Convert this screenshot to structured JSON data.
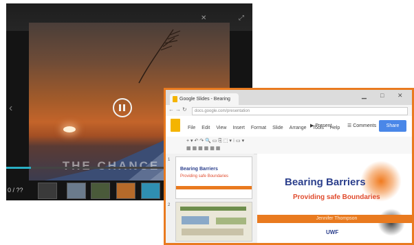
{
  "video_player": {
    "title": "",
    "caption": "THE CHANCE",
    "time_label": "0 / ??",
    "progress": 0.1,
    "controls": [
      "close-icon",
      "fullscreen-icon"
    ],
    "thumbnails": 7
  },
  "slides_window": {
    "tab_title": "Google Slides - Bearing",
    "url": "docs.google.com/presentation",
    "menu": [
      "File",
      "Edit",
      "View",
      "Insert",
      "Format",
      "Slide",
      "Arrange",
      "Tools",
      "Help"
    ],
    "present_label": "Present",
    "comments_label": "Comments",
    "share_label": "Share",
    "slide": {
      "title": "Bearing Barriers",
      "subtitle": "Providing safe Boundaries",
      "band_text": "Jennifer Thompson",
      "footer": "UWF"
    },
    "thumbnails": [
      {
        "title": "Bearing Barriers",
        "subtitle": "Providing safe Boundaries"
      },
      {
        "title": "",
        "subtitle": ""
      }
    ]
  }
}
